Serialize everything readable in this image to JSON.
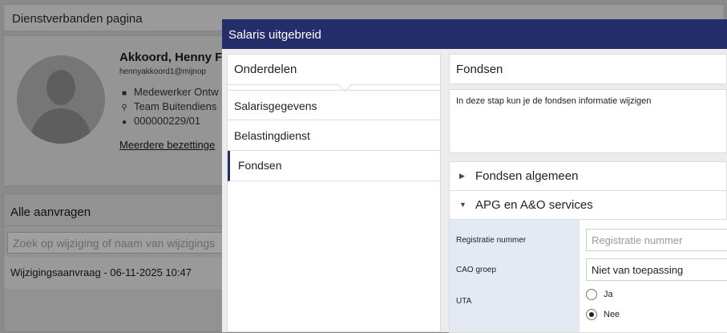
{
  "background": {
    "page_title": "Dienstverbanden pagina",
    "profile": {
      "name": "Akkoord, Henny F",
      "email": "hennyakkoord1@mijnop",
      "role": "Medewerker Ontw",
      "team": "Team Buitendiens",
      "employee_number": "000000229/01",
      "more_link": "Meerdere bezettinge"
    },
    "requests": {
      "title": "Alle aanvragen",
      "search_placeholder": "Zoek op wijziging of naam van wijzigings",
      "items": [
        "Wijzigingsaanvraag - 06-11-2025 10:47"
      ]
    }
  },
  "modal": {
    "title": "Salaris uitgebreid",
    "left": {
      "header": "Onderdelen",
      "items": [
        "Salarisgegevens",
        "Belastingdienst",
        "Fondsen"
      ],
      "active_index": 2
    },
    "right": {
      "header": "Fondsen",
      "description": "In deze stap kun je de fondsen informatie wijzigen",
      "sections": [
        {
          "label": "Fondsen algemeen",
          "expanded": false
        },
        {
          "label": "APG en A&O services",
          "expanded": true
        }
      ],
      "form": {
        "registratie_label": "Registratie nummer",
        "registratie_placeholder": "Registratie nummer",
        "cao_label": "CAO groep",
        "cao_value": "Niet van toepassing",
        "uta_label": "UTA",
        "uta_options": [
          "Ja",
          "Nee"
        ],
        "uta_selected": "Nee"
      }
    }
  },
  "colors": {
    "modal_header": "#232e6b",
    "overlay": "#8a8a8a",
    "form_bg": "#e4eaf4"
  },
  "icons": [
    "briefcase-icon",
    "location-pin-icon",
    "person-icon",
    "caret-right-icon",
    "caret-down-icon"
  ]
}
